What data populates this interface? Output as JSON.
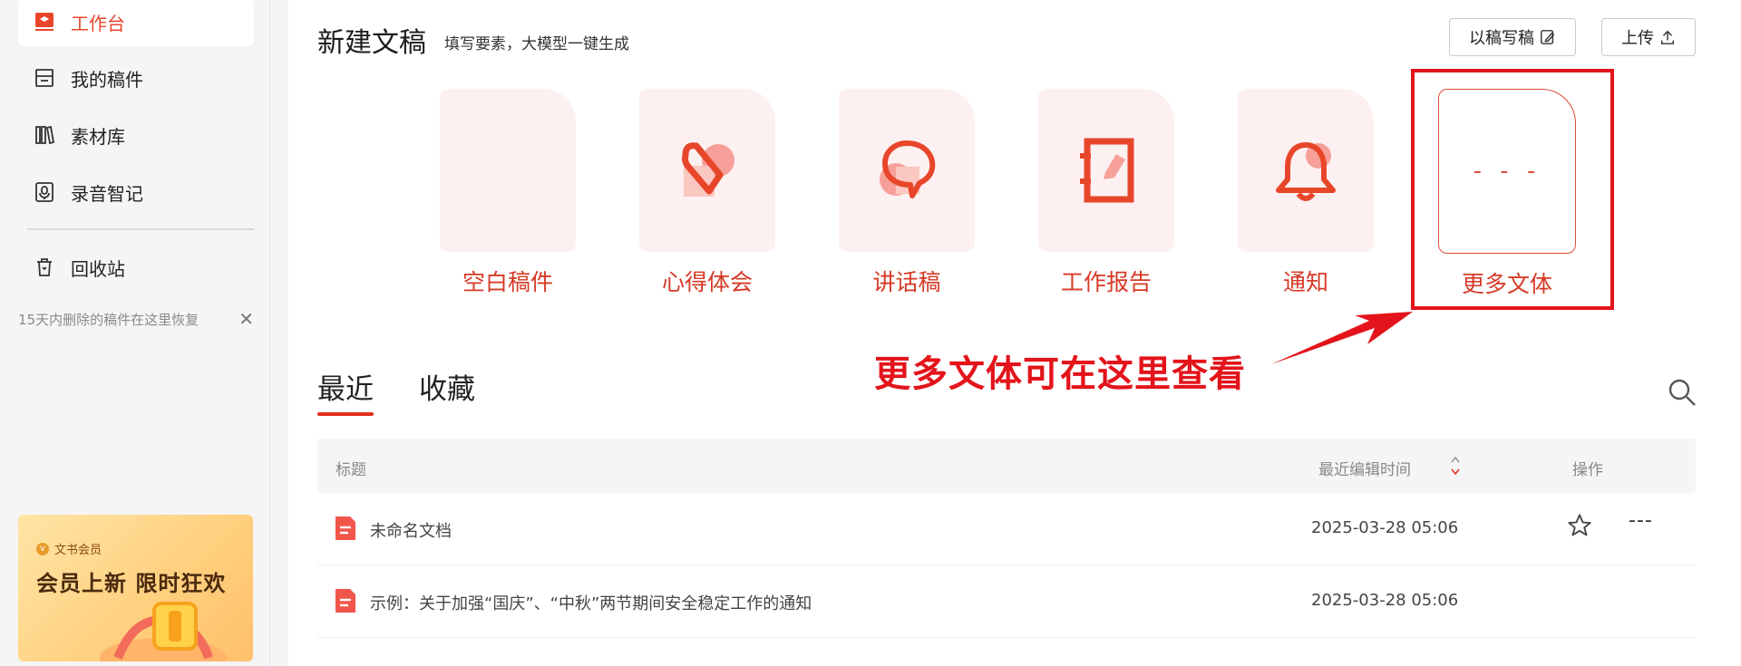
{
  "sidebar": {
    "items": [
      {
        "label": "工作台",
        "icon": "workbench-icon",
        "active": true
      },
      {
        "label": "我的稿件",
        "icon": "folder-icon"
      },
      {
        "label": "素材库",
        "icon": "library-icon"
      },
      {
        "label": "录音智记",
        "icon": "recorder-icon"
      },
      {
        "label": "回收站",
        "icon": "trash-icon"
      }
    ],
    "recycle_tip": "15天内删除的稿件在这里恢复",
    "close_glyph": "✕",
    "promo": {
      "badge": "文书会员",
      "badge_glyph": "v",
      "title": "会员上新 限时狂欢"
    }
  },
  "header": {
    "title": "新建文稿",
    "subtitle": "填写要素，大模型一键生成",
    "btn_rewrite": "以稿写稿",
    "btn_upload": "上传"
  },
  "templates": [
    {
      "label": "空白稿件",
      "icon": "blank-doc-icon"
    },
    {
      "label": "心得体会",
      "icon": "heart-icon"
    },
    {
      "label": "讲话稿",
      "icon": "speech-icon"
    },
    {
      "label": "工作报告",
      "icon": "report-book-icon"
    },
    {
      "label": "通知",
      "icon": "bell-icon"
    },
    {
      "label": "更多文体",
      "icon": "more-dots-icon",
      "glyph": "- - -"
    }
  ],
  "annotation": "更多文体可在这里查看",
  "tabs": [
    "最近",
    "收藏"
  ],
  "table": {
    "headers": {
      "title": "标题",
      "time": "最近编辑时间",
      "action": "操作"
    },
    "rows": [
      {
        "title": "未命名文档",
        "time": "2025-03-28 05:06",
        "more": "---"
      },
      {
        "title": "示例：关于加强“国庆”、“中秋”两节期间安全稳定工作的通知",
        "time": "2025-03-28 05:06"
      }
    ]
  },
  "colors": {
    "accent": "#e8462b",
    "highlight": "#e3141b",
    "card_bg": "#fdf0f0"
  }
}
